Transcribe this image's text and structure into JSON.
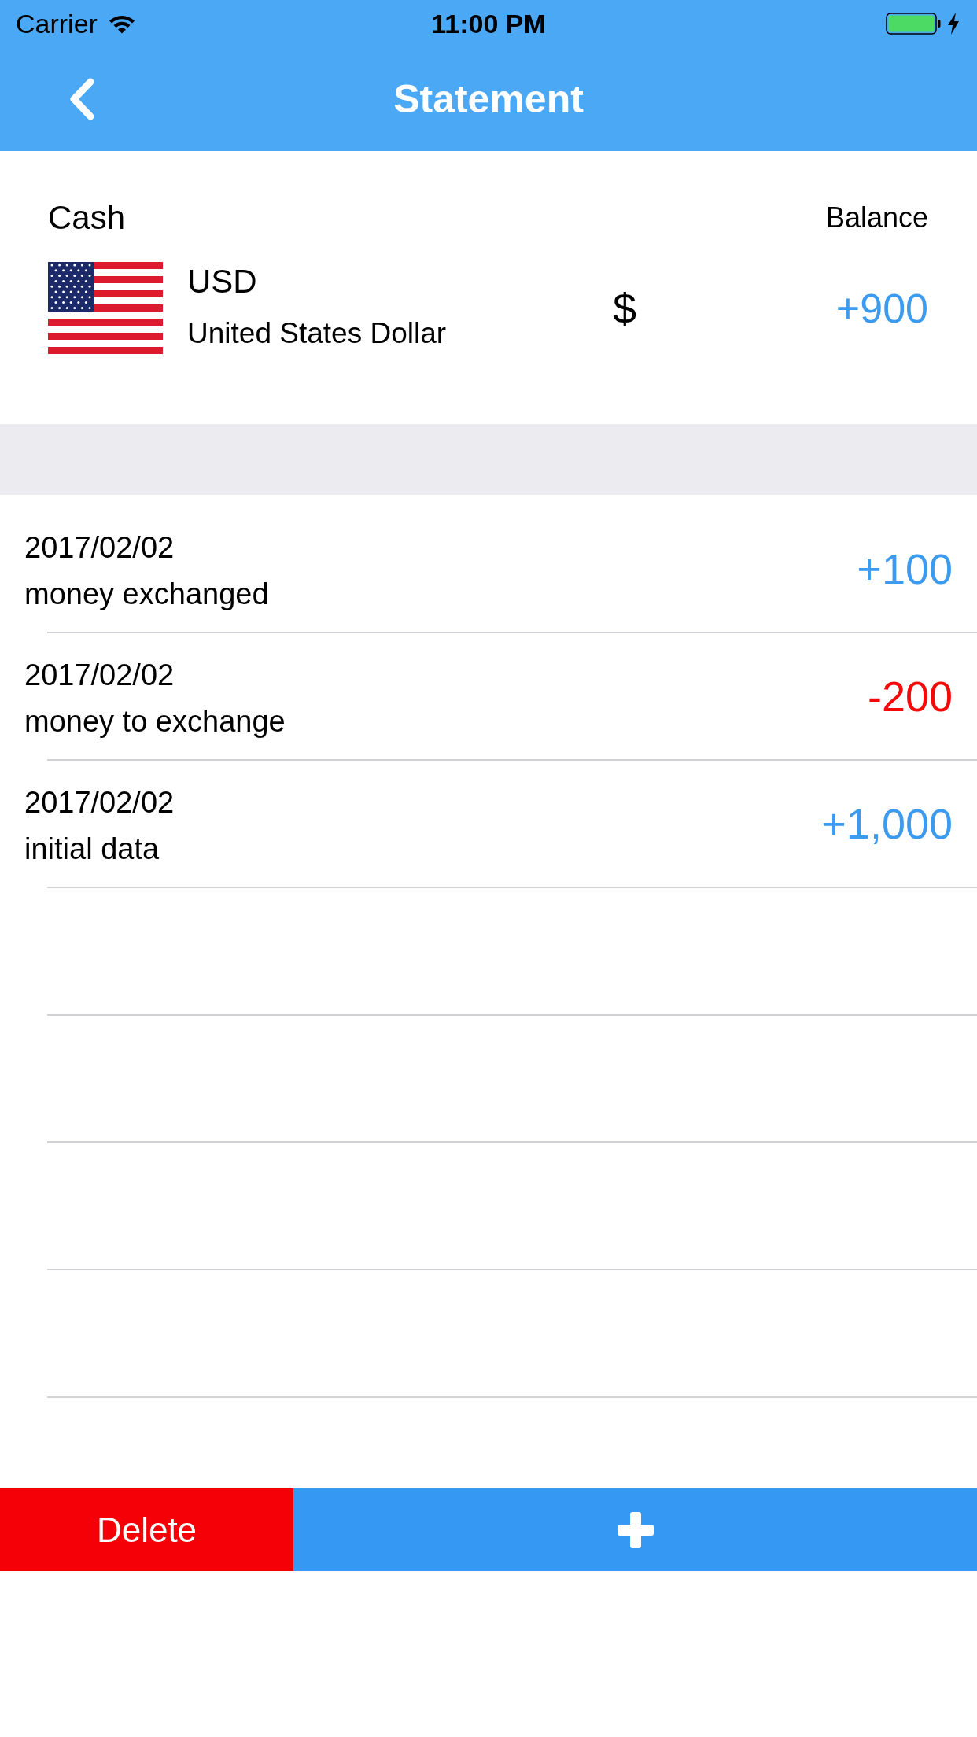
{
  "status_bar": {
    "carrier": "Carrier",
    "time": "11:00 PM"
  },
  "nav_bar": {
    "title": "Statement"
  },
  "account": {
    "name": "Cash",
    "balance_label": "Balance",
    "currency_code": "USD",
    "currency_name": "United States Dollar",
    "currency_symbol": "$",
    "balance": "+900"
  },
  "transactions": [
    {
      "date": "2017/02/02",
      "description": "money exchanged",
      "amount": "+100",
      "color": "#3d9bef"
    },
    {
      "date": "2017/02/02",
      "description": "money to exchange",
      "amount": "-200",
      "color": "#f50a0a"
    },
    {
      "date": "2017/02/02",
      "description": "initial data",
      "amount": "+1,000",
      "color": "#3d9bef"
    }
  ],
  "actions": {
    "delete": "Delete"
  }
}
